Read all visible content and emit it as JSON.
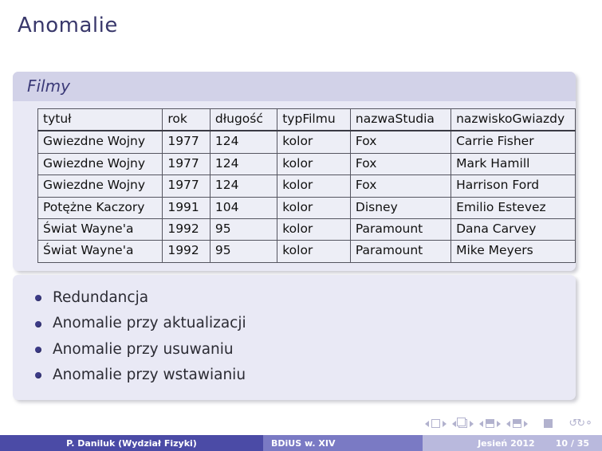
{
  "slide": {
    "title": "Anomalie"
  },
  "filmy_block": {
    "title": "Filmy",
    "table": {
      "columns": [
        "tytuł",
        "rok",
        "długość",
        "typFilmu",
        "nazwaStudia",
        "nazwiskoGwiazdy"
      ],
      "rows": [
        [
          "Gwiezdne Wojny",
          "1977",
          "124",
          "kolor",
          "Fox",
          "Carrie Fisher"
        ],
        [
          "Gwiezdne Wojny",
          "1977",
          "124",
          "kolor",
          "Fox",
          "Mark Hamill"
        ],
        [
          "Gwiezdne Wojny",
          "1977",
          "124",
          "kolor",
          "Fox",
          "Harrison Ford"
        ],
        [
          "Potężne Kaczory",
          "1991",
          "104",
          "kolor",
          "Disney",
          "Emilio Estevez"
        ],
        [
          "Świat Wayne'a",
          "1992",
          "95",
          "kolor",
          "Paramount",
          "Dana Carvey"
        ],
        [
          "Świat Wayne'a",
          "1992",
          "95",
          "kolor",
          "Paramount",
          "Mike Meyers"
        ]
      ]
    }
  },
  "bullets_block": {
    "items": [
      "Redundancja",
      "Anomalie przy aktualizacji",
      "Anomalie przy usuwaniu",
      "Anomalie przy wstawianiu"
    ]
  },
  "navigation": {
    "icons": [
      "nav-first-slide-icon",
      "nav-previous-slide-icon",
      "nav-next-slide-icon",
      "nav-last-slide-icon",
      "nav-back-icon",
      "nav-forward-icon",
      "nav-search-icon"
    ]
  },
  "footer": {
    "author": "P. Daniluk  (Wydział Fizyki)",
    "subject": "BDiUS w. XIV",
    "date": "Jesień 2012",
    "page": "10 / 35"
  },
  "colors": {
    "title": "#39386b",
    "block_title_bg": "#d2d2e8",
    "block_body_bg": "#e9e9f5",
    "footer_author_bg": "#4b4ba6",
    "footer_subject_bg": "#7a7ac4",
    "footer_right_bg": "#b9b9dd",
    "bullet": "#3b3a85"
  }
}
